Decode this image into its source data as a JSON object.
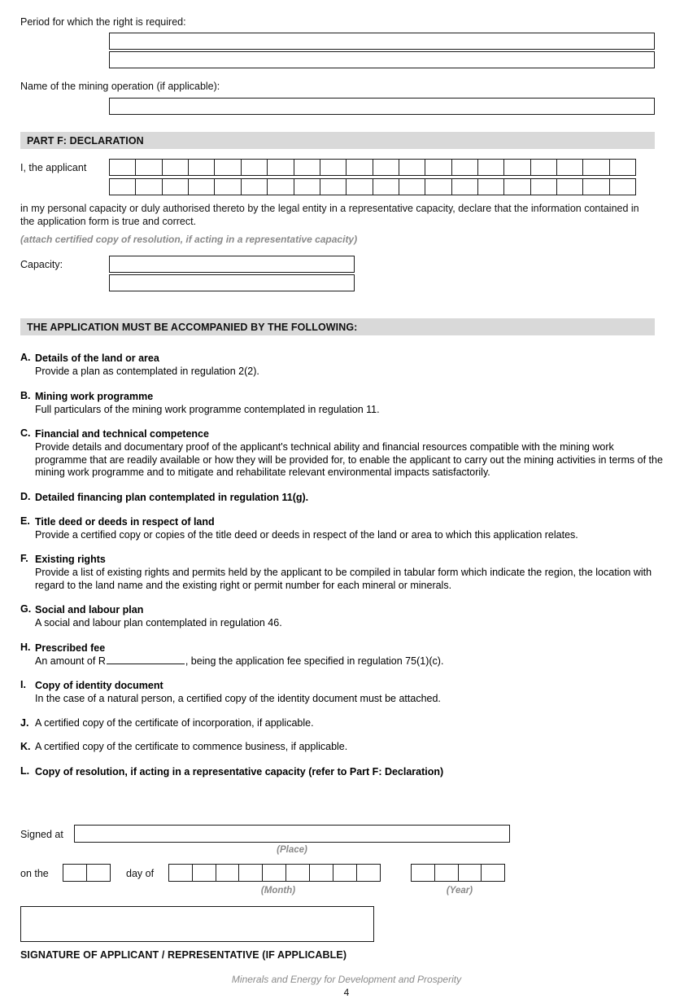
{
  "form": {
    "period_label": "Period for which the right is required:",
    "operation_label": "Name of the mining operation (if applicable):",
    "part_f_heading": "PART F: DECLARATION",
    "applicant_label": "I, the applicant",
    "declaration_text": "in my personal capacity or duly authorised thereto by the legal entity in a representative capacity, declare that the information contained in the application form is true and correct.",
    "resolution_note": "(attach certified copy of resolution, if acting in a representative capacity)",
    "capacity_label": "Capacity:",
    "period_line_1": "",
    "period_line_2": "",
    "operation_value": "",
    "applicant_row_1": "",
    "applicant_row_2": "",
    "capacity_line_1": "",
    "capacity_line_2": "",
    "applicant_boxes": 20,
    "accent_gray": "#d9d9d9"
  },
  "attachments": {
    "heading": "THE APPLICATION MUST BE ACCOMPANIED BY THE FOLLOWING:",
    "items": [
      {
        "letter": "A.",
        "title": "Details of the land or area",
        "desc": "Provide a plan as contemplated in regulation 2(2)."
      },
      {
        "letter": "B.",
        "title": "Mining work programme",
        "desc": "Full particulars of the mining work programme contemplated in regulation 11."
      },
      {
        "letter": "C.",
        "title": "Financial and technical competence",
        "desc": "Provide details and documentary proof of the applicant's technical ability and financial resources compatible with the mining work programme that are readily available or how they will be provided for, to enable the applicant to carry out the mining activities in terms of the mining work programme and to mitigate and rehabilitate relevant environmental impacts satisfactorily."
      },
      {
        "letter": "D.",
        "title": "Detailed financing plan contemplated in regulation 11(g).",
        "desc": ""
      },
      {
        "letter": "E.",
        "title": "Title deed or deeds in respect of land",
        "desc": "Provide a certified copy or copies of the title deed or deeds in respect of the land or area to which this application relates."
      },
      {
        "letter": "F.",
        "title": "Existing rights",
        "desc": "Provide a list of existing rights and permits held by the applicant to be compiled in tabular form which indicate the region, the location with regard to the land name and the existing right or permit number for each mineral or minerals."
      },
      {
        "letter": "G.",
        "title": "Social and labour plan",
        "desc": "A social and labour plan contemplated in regulation 46."
      },
      {
        "letter": "H.",
        "title": "Prescribed fee",
        "desc_before_blank": "An amount of R",
        "desc_after_blank": ", being the application fee specified in regulation 75(1)(c).",
        "desc": ""
      },
      {
        "letter": "I.",
        "title": "Copy of identity document",
        "desc": "In the case of a natural person, a certified copy of the identity document must be attached."
      },
      {
        "letter": "J.",
        "title": "",
        "desc": "A certified copy of the certificate of incorporation, if applicable."
      },
      {
        "letter": "K.",
        "title": "",
        "desc": "A certified copy of the certificate to commence business, if applicable."
      },
      {
        "letter": "L.",
        "title": "Copy of resolution, if acting in a representative capacity (refer to Part F: Declaration)",
        "desc": ""
      }
    ]
  },
  "signature": {
    "signed_at_label": "Signed at",
    "signed_at_value": "",
    "place_caption": "(Place)",
    "on_the_label": "on the",
    "day_of_label": "day of",
    "month_caption": "(Month)",
    "year_caption": "(Year)",
    "day_boxes": 2,
    "month_boxes": 9,
    "year_boxes": 4,
    "signature_box_value": "",
    "signature_label": "SIGNATURE OF APPLICANT / REPRESENTATIVE (IF APPLICABLE)"
  },
  "footer": {
    "tagline": "Minerals and Energy for Development and Prosperity",
    "page_number": "4"
  }
}
